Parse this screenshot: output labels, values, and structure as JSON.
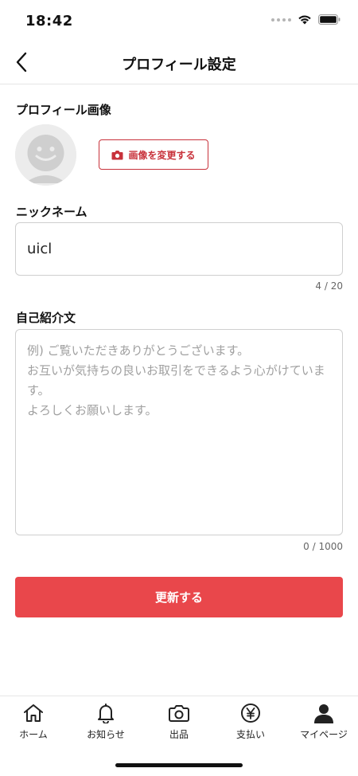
{
  "status_bar": {
    "time": "18:42"
  },
  "header": {
    "title": "プロフィール設定",
    "back_icon": "chevron-left-icon"
  },
  "profile_image": {
    "label": "プロフィール画像",
    "change_button_label": "画像を変更する",
    "change_button_icon": "camera-icon"
  },
  "nickname": {
    "label": "ニックネーム",
    "value": "uicl",
    "counter": "4 / 20"
  },
  "bio": {
    "label": "自己紹介文",
    "value": "",
    "placeholder": "例) ご覧いただきありがとうございます。\nお互いが気持ちの良いお取引をできるよう心がけています。\nよろしくお願いします。",
    "counter": "0 / 1000"
  },
  "submit": {
    "label": "更新する"
  },
  "colors": {
    "accent": "#e9474b",
    "accent_dark": "#c8323b",
    "border": "#cfcfcf"
  },
  "tab_bar": {
    "items": [
      {
        "label": "ホーム",
        "icon": "home-icon"
      },
      {
        "label": "お知らせ",
        "icon": "bell-icon"
      },
      {
        "label": "出品",
        "icon": "camera-icon"
      },
      {
        "label": "支払い",
        "icon": "yen-icon"
      },
      {
        "label": "マイページ",
        "icon": "person-icon"
      }
    ]
  }
}
